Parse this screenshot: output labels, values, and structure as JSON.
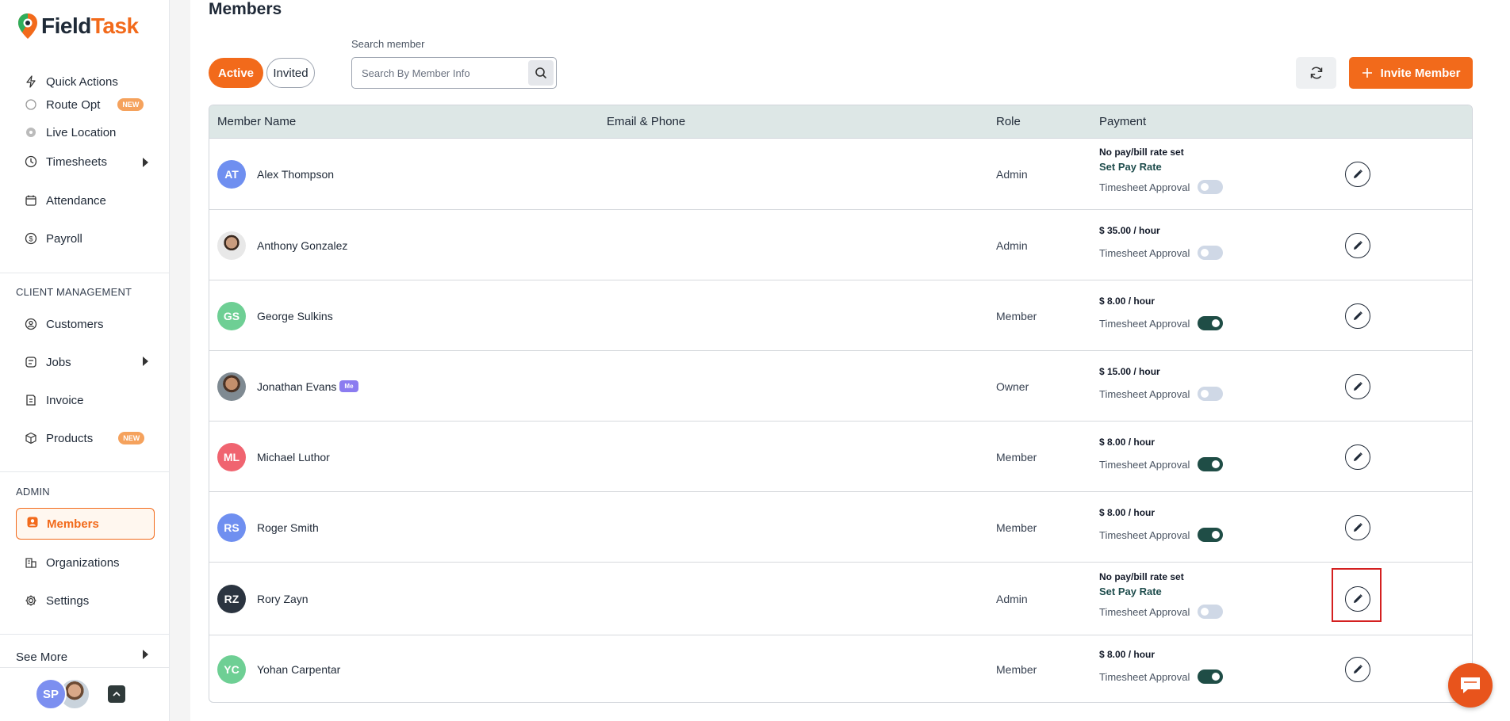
{
  "app": {
    "logo_part1": "Field",
    "logo_part2": "Task"
  },
  "sidebar": {
    "items_top": [
      {
        "label": "Quick Actions",
        "icon": "lightning-icon"
      },
      {
        "label": "Route Opt",
        "icon": "route-icon",
        "badge": "NEW"
      },
      {
        "label": "Live Location",
        "icon": "location-icon"
      },
      {
        "label": "Timesheets",
        "icon": "clock-icon",
        "has_arrow": true
      },
      {
        "label": "Attendance",
        "icon": "calendar-icon"
      },
      {
        "label": "Payroll",
        "icon": "dollar-icon"
      }
    ],
    "client_section_label": "CLIENT MANAGEMENT",
    "items_client": [
      {
        "label": "Customers",
        "icon": "customers-icon"
      },
      {
        "label": "Jobs",
        "icon": "jobs-icon",
        "has_arrow": true
      },
      {
        "label": "Invoice",
        "icon": "invoice-icon"
      },
      {
        "label": "Products",
        "icon": "box-icon",
        "badge": "NEW"
      }
    ],
    "admin_section_label": "ADMIN",
    "active_item": "Members",
    "items_admin": [
      {
        "label": "Organizations",
        "icon": "organizations-icon"
      },
      {
        "label": "Settings",
        "icon": "gear-icon"
      }
    ],
    "see_more": "See More",
    "user_initials": "SP"
  },
  "main": {
    "title": "Members",
    "tabs": {
      "active": "Active",
      "invited": "Invited"
    },
    "search": {
      "label": "Search member",
      "placeholder": "Search By Member Info"
    },
    "invite_label": "Invite Member",
    "columns": [
      "Member Name",
      "Email & Phone",
      "Role",
      "Payment"
    ],
    "approval_label": "Timesheet Approval",
    "set_pay_rate_label": "Set Pay Rate",
    "members": [
      {
        "initials": "AT",
        "name": "Alex Thompson",
        "role": "Admin",
        "pay": "No pay/bill rate set",
        "set_rate": true,
        "approval": false,
        "color": "#6f8ff0"
      },
      {
        "initials": "",
        "name": "Anthony Gonzalez",
        "role": "Admin",
        "pay": "$ 35.00 / hour",
        "set_rate": false,
        "approval": false,
        "photo": "photo1"
      },
      {
        "initials": "GS",
        "name": "George Sulkins",
        "role": "Member",
        "pay": "$ 8.00 / hour",
        "set_rate": false,
        "approval": true,
        "color": "#6ecf94"
      },
      {
        "initials": "",
        "name": "Jonathan Evans",
        "role": "Owner",
        "pay": "$ 15.00 / hour",
        "set_rate": false,
        "approval": false,
        "photo": "photo2",
        "me_badge": "Me"
      },
      {
        "initials": "ML",
        "name": "Michael Luthor",
        "role": "Member",
        "pay": "$ 8.00 / hour",
        "set_rate": false,
        "approval": true,
        "color": "#f06470"
      },
      {
        "initials": "RS",
        "name": "Roger Smith",
        "role": "Member",
        "pay": "$ 8.00 / hour",
        "set_rate": false,
        "approval": true,
        "color": "#6f8ff0"
      },
      {
        "initials": "RZ",
        "name": "Rory Zayn",
        "role": "Admin",
        "pay": "No pay/bill rate set",
        "set_rate": true,
        "approval": false,
        "color": "#2b3440"
      },
      {
        "initials": "YC",
        "name": "Yohan Carpentar",
        "role": "Member",
        "pay": "$ 8.00 / hour",
        "set_rate": false,
        "approval": true,
        "color": "#6ecf94"
      }
    ]
  },
  "colors": {
    "accent": "#f26a1b",
    "toggle_on": "#1f4d46",
    "table_header": "#dde7e6"
  }
}
